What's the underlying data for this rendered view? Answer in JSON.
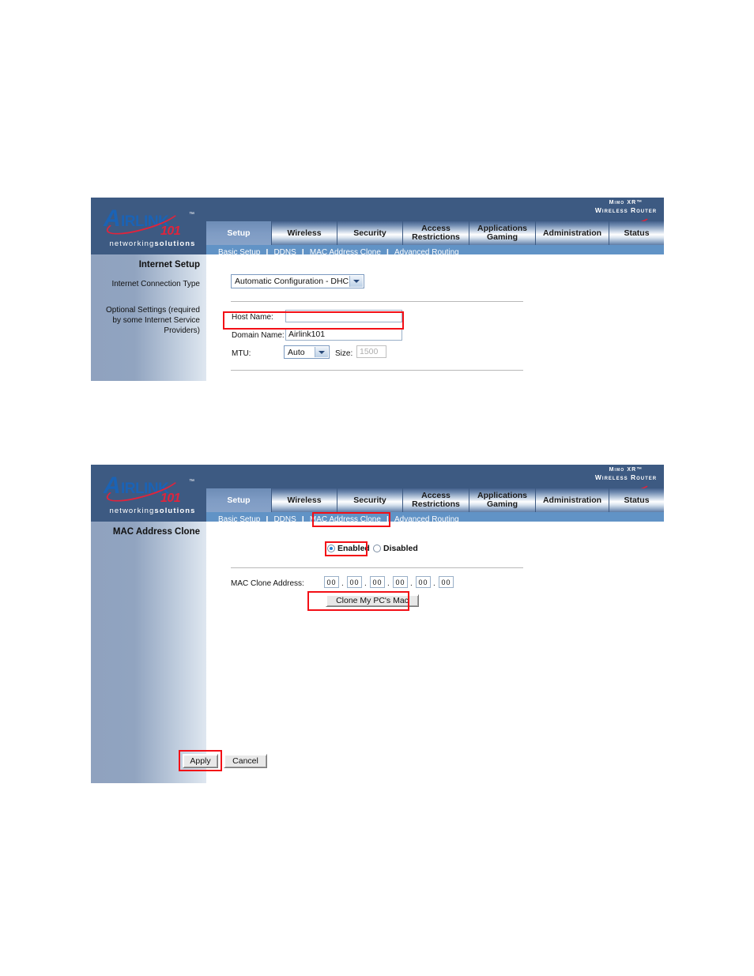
{
  "brand": {
    "logo_a": "A",
    "logo_rest": "IRLINK",
    "logo_tm": "™",
    "logo_101": "101",
    "tagline_light": "networking",
    "tagline_bold": "solutions",
    "mimo_line1": "Mimo XR™",
    "mimo_line2": "Wireless Router"
  },
  "nav": {
    "tabs": [
      {
        "label": "Setup",
        "active": true
      },
      {
        "label": "Wireless",
        "active": false
      },
      {
        "label": "Security",
        "active": false
      },
      {
        "label": "Access\nRestrictions",
        "active": false
      },
      {
        "label": "Applications\nGaming",
        "active": false
      },
      {
        "label": "Administration",
        "active": false
      },
      {
        "label": "Status",
        "active": false
      }
    ],
    "subnav": [
      "Basic Setup",
      "DDNS",
      "MAC Address Clone",
      "Advanced Routing"
    ],
    "separator": "|"
  },
  "panel1": {
    "sidebar_title": "Internet Setup",
    "label_connection_type": "Internet Connection Type",
    "label_optional": "Optional Settings (required by some Internet Service Providers)",
    "connection_type_value": "Automatic Configuration - DHCP",
    "host_name_label": "Host Name:",
    "host_name_value": "",
    "domain_name_label": "Domain Name:",
    "domain_name_value": "Airlink101",
    "mtu_label": "MTU:",
    "mtu_value": "Auto",
    "size_label": "Size:",
    "size_value": "1500"
  },
  "panel2": {
    "sidebar_title": "MAC Address Clone",
    "radio_enabled": "Enabled",
    "radio_disabled": "Disabled",
    "enabled_selected": true,
    "mac_label": "MAC Clone Address:",
    "mac_octets": [
      "00",
      "00",
      "00",
      "00",
      "00",
      "00"
    ],
    "mac_dot": ".",
    "clone_button": "Clone My PC's Mac",
    "apply_button": "Apply",
    "cancel_button": "Cancel"
  },
  "highlight_color": "#f30f16"
}
